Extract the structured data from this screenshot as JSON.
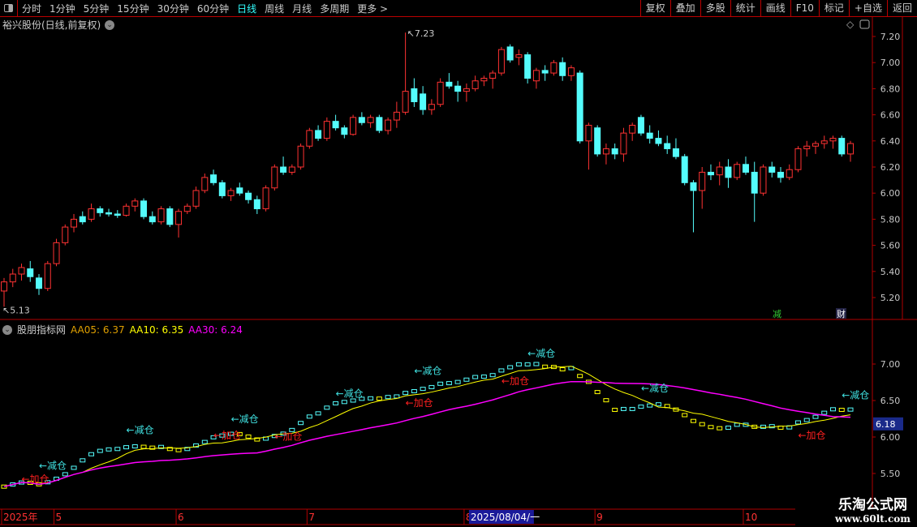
{
  "toolbar": {
    "periods": [
      "分时",
      "1分钟",
      "5分钟",
      "15分钟",
      "30分钟",
      "60分钟",
      "日线",
      "周线",
      "月线",
      "多周期",
      "更多 >"
    ],
    "active": "日线",
    "right": [
      "复权",
      "叠加",
      "多股",
      "统计",
      "画线",
      "F10",
      "标记",
      "+自选",
      "返回"
    ]
  },
  "main": {
    "title": "裕兴股份(日线,前复权)",
    "high_label": "7.23",
    "low_label": "5.13",
    "markers": [
      "减",
      "财"
    ]
  },
  "indicator": {
    "name": "股朋指标网",
    "aa05": "AA05: 6.37",
    "aa10": "AA10: 6.35",
    "aa30": "AA30: 6.24",
    "current_value": "6.18",
    "annotations": [
      {
        "text": "←加仓",
        "i": 2,
        "v": 5.38,
        "color": "#ff2020"
      },
      {
        "text": "←减仓",
        "i": 4,
        "v": 5.56,
        "color": "#40e0e0"
      },
      {
        "text": "←减仓",
        "i": 14,
        "v": 6.05,
        "color": "#40e0e0"
      },
      {
        "text": "←加仓",
        "i": 24,
        "v": 5.98,
        "color": "#ff2020"
      },
      {
        "text": "←减仓",
        "i": 26,
        "v": 6.2,
        "color": "#40e0e0"
      },
      {
        "text": "←加仓",
        "i": 31,
        "v": 5.96,
        "color": "#ff2020"
      },
      {
        "text": "←减仓",
        "i": 38,
        "v": 6.55,
        "color": "#40e0e0"
      },
      {
        "text": "←加仓",
        "i": 46,
        "v": 6.42,
        "color": "#ff2020"
      },
      {
        "text": "←减仓",
        "i": 47,
        "v": 6.86,
        "color": "#40e0e0"
      },
      {
        "text": "←加仓",
        "i": 57,
        "v": 6.72,
        "color": "#ff2020"
      },
      {
        "text": "←减仓",
        "i": 60,
        "v": 7.1,
        "color": "#40e0e0"
      },
      {
        "text": "←减仓",
        "i": 73,
        "v": 6.62,
        "color": "#40e0e0"
      },
      {
        "text": "←加仓",
        "i": 91,
        "v": 5.98,
        "color": "#ff2020"
      },
      {
        "text": "←减仓",
        "i": 96,
        "v": 6.53,
        "color": "#40e0e0"
      }
    ]
  },
  "xaxis": {
    "labels": [
      {
        "t": "2025年",
        "i": 0
      },
      {
        "t": "5",
        "i": 6
      },
      {
        "t": "6",
        "i": 20
      },
      {
        "t": "7",
        "i": 35
      },
      {
        "t": "8",
        "i": 53
      },
      {
        "t": "9",
        "i": 68
      },
      {
        "t": "10",
        "i": 85
      }
    ],
    "cursor_date": "2025/08/04/一"
  },
  "watermark": {
    "line1": "乐淘公式网",
    "line2": "www.60lt.com"
  },
  "colors": {
    "up": "#ff3232",
    "down": "#54fcfc",
    "aa05": "#e0a000",
    "aa10": "#ffff00",
    "aa30": "#ff00ff",
    "border": "#b00000"
  },
  "chart_data": {
    "type": "candlestick",
    "yticks": [
      5.2,
      5.4,
      5.6,
      5.8,
      6.0,
      6.2,
      6.4,
      6.6,
      6.8,
      7.0,
      7.2
    ],
    "ylim": [
      5.1,
      7.3
    ],
    "ind_yticks": [
      5.5,
      6.0,
      6.5,
      7.0
    ],
    "ind_ylim": [
      5.3,
      7.2
    ],
    "ohlc": [
      [
        5.25,
        5.35,
        5.13,
        5.32
      ],
      [
        5.32,
        5.42,
        5.28,
        5.38
      ],
      [
        5.38,
        5.46,
        5.33,
        5.43
      ],
      [
        5.42,
        5.48,
        5.32,
        5.36
      ],
      [
        5.35,
        5.38,
        5.22,
        5.27
      ],
      [
        5.27,
        5.48,
        5.25,
        5.46
      ],
      [
        5.46,
        5.65,
        5.44,
        5.62
      ],
      [
        5.62,
        5.76,
        5.6,
        5.74
      ],
      [
        5.74,
        5.84,
        5.7,
        5.8
      ],
      [
        5.82,
        5.86,
        5.76,
        5.78
      ],
      [
        5.8,
        5.92,
        5.78,
        5.88
      ],
      [
        5.88,
        5.9,
        5.82,
        5.85
      ],
      [
        5.85,
        5.88,
        5.82,
        5.84
      ],
      [
        5.84,
        5.87,
        5.81,
        5.83
      ],
      [
        5.83,
        5.92,
        5.82,
        5.9
      ],
      [
        5.9,
        5.96,
        5.86,
        5.94
      ],
      [
        5.94,
        5.96,
        5.8,
        5.82
      ],
      [
        5.82,
        5.86,
        5.76,
        5.78
      ],
      [
        5.78,
        5.9,
        5.76,
        5.88
      ],
      [
        5.88,
        5.9,
        5.74,
        5.76
      ],
      [
        5.76,
        5.88,
        5.66,
        5.86
      ],
      [
        5.86,
        5.92,
        5.84,
        5.9
      ],
      [
        5.9,
        6.05,
        5.88,
        6.02
      ],
      [
        6.02,
        6.15,
        6.0,
        6.12
      ],
      [
        6.14,
        6.18,
        6.06,
        6.08
      ],
      [
        6.08,
        6.1,
        5.96,
        5.98
      ],
      [
        5.98,
        6.04,
        5.94,
        6.02
      ],
      [
        6.04,
        6.08,
        5.98,
        6.0
      ],
      [
        6.0,
        6.02,
        5.92,
        5.95
      ],
      [
        5.95,
        5.98,
        5.84,
        5.88
      ],
      [
        5.88,
        6.06,
        5.86,
        6.04
      ],
      [
        6.04,
        6.22,
        6.02,
        6.2
      ],
      [
        6.2,
        6.28,
        6.14,
        6.16
      ],
      [
        6.16,
        6.22,
        6.14,
        6.2
      ],
      [
        6.2,
        6.38,
        6.18,
        6.36
      ],
      [
        6.36,
        6.5,
        6.34,
        6.48
      ],
      [
        6.48,
        6.52,
        6.4,
        6.42
      ],
      [
        6.42,
        6.58,
        6.4,
        6.55
      ],
      [
        6.55,
        6.6,
        6.48,
        6.5
      ],
      [
        6.5,
        6.52,
        6.42,
        6.45
      ],
      [
        6.45,
        6.6,
        6.44,
        6.58
      ],
      [
        6.58,
        6.62,
        6.52,
        6.54
      ],
      [
        6.54,
        6.6,
        6.5,
        6.58
      ],
      [
        6.58,
        6.6,
        6.46,
        6.48
      ],
      [
        6.48,
        6.58,
        6.45,
        6.56
      ],
      [
        6.56,
        6.7,
        6.5,
        6.62
      ],
      [
        6.62,
        7.23,
        6.6,
        6.78
      ],
      [
        6.8,
        6.88,
        6.66,
        6.7
      ],
      [
        6.76,
        6.82,
        6.6,
        6.64
      ],
      [
        6.64,
        6.72,
        6.6,
        6.68
      ],
      [
        6.68,
        6.88,
        6.66,
        6.85
      ],
      [
        6.85,
        6.92,
        6.8,
        6.82
      ],
      [
        6.82,
        6.86,
        6.7,
        6.78
      ],
      [
        6.78,
        6.84,
        6.7,
        6.8
      ],
      [
        6.8,
        6.9,
        6.78,
        6.86
      ],
      [
        6.86,
        6.9,
        6.82,
        6.88
      ],
      [
        6.88,
        6.94,
        6.8,
        6.92
      ],
      [
        6.92,
        7.12,
        6.9,
        7.1
      ],
      [
        7.12,
        7.14,
        7.0,
        7.02
      ],
      [
        7.04,
        7.1,
        6.98,
        7.06
      ],
      [
        7.06,
        7.08,
        6.84,
        6.88
      ],
      [
        6.86,
        6.96,
        6.8,
        6.94
      ],
      [
        6.94,
        6.98,
        6.86,
        6.92
      ],
      [
        6.92,
        7.02,
        6.9,
        7.0
      ],
      [
        7.0,
        7.04,
        6.86,
        6.9
      ],
      [
        6.9,
        6.98,
        6.86,
        6.96
      ],
      [
        6.92,
        6.94,
        6.38,
        6.4
      ],
      [
        6.4,
        6.54,
        6.18,
        6.52
      ],
      [
        6.5,
        6.52,
        6.28,
        6.3
      ],
      [
        6.3,
        6.38,
        6.22,
        6.34
      ],
      [
        6.34,
        6.38,
        6.26,
        6.3
      ],
      [
        6.3,
        6.5,
        6.24,
        6.46
      ],
      [
        6.46,
        6.54,
        6.4,
        6.52
      ],
      [
        6.58,
        6.6,
        6.44,
        6.46
      ],
      [
        6.46,
        6.52,
        6.38,
        6.42
      ],
      [
        6.42,
        6.48,
        6.36,
        6.38
      ],
      [
        6.38,
        6.44,
        6.3,
        6.34
      ],
      [
        6.34,
        6.42,
        6.26,
        6.28
      ],
      [
        6.28,
        6.3,
        6.06,
        6.08
      ],
      [
        6.08,
        6.1,
        5.7,
        6.02
      ],
      [
        6.02,
        6.2,
        5.88,
        6.16
      ],
      [
        6.16,
        6.22,
        6.1,
        6.14
      ],
      [
        6.14,
        6.24,
        6.06,
        6.2
      ],
      [
        6.2,
        6.26,
        6.04,
        6.12
      ],
      [
        6.12,
        6.24,
        6.1,
        6.22
      ],
      [
        6.22,
        6.28,
        6.14,
        6.16
      ],
      [
        6.16,
        6.24,
        5.78,
        6.0
      ],
      [
        6.0,
        6.22,
        5.98,
        6.2
      ],
      [
        6.2,
        6.24,
        6.12,
        6.16
      ],
      [
        6.16,
        6.2,
        6.08,
        6.12
      ],
      [
        6.12,
        6.22,
        6.1,
        6.18
      ],
      [
        6.18,
        6.36,
        6.16,
        6.34
      ],
      [
        6.34,
        6.4,
        6.28,
        6.36
      ],
      [
        6.36,
        6.4,
        6.3,
        6.38
      ],
      [
        6.38,
        6.44,
        6.34,
        6.4
      ],
      [
        6.4,
        6.44,
        6.34,
        6.42
      ],
      [
        6.42,
        6.44,
        6.28,
        6.3
      ],
      [
        6.3,
        6.4,
        6.24,
        6.38
      ]
    ]
  }
}
